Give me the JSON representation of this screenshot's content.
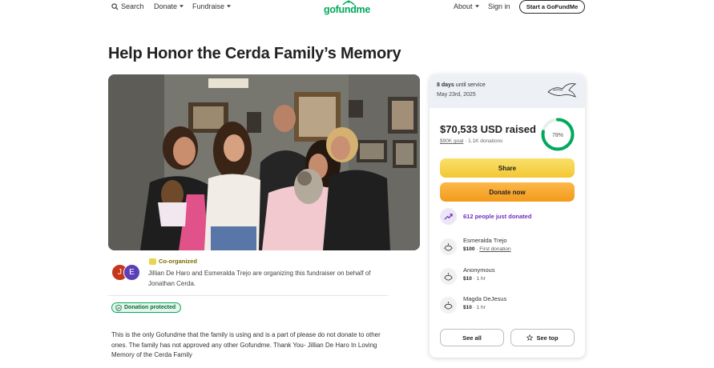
{
  "nav": {
    "search": "Search",
    "donate": "Donate",
    "fundraise": "Fundraise",
    "logo": "gofundme",
    "about": "About",
    "signin": "Sign in",
    "start": "Start a GoFundMe"
  },
  "page_title": "Help Honor the Cerda Family’s Memory",
  "organizer": {
    "initials": [
      "J",
      "E"
    ],
    "co_organized": "Co-organized",
    "text": "Jillian De Haro and Esmeralda Trejo are organizing this fundraiser on behalf of Jonathan Cerda.",
    "badge": "Donation protected"
  },
  "story": "This is the only Gofundme that the family is using and is a part of please do not donate to other ones. The family has not approved any other Gofundme. Thank You- Jillian De Haro In Loving Memory of the Cerda Family",
  "card": {
    "days": "8 days",
    "until": "until service",
    "service_date": "May 23rd, 2025",
    "raised": "$70,533 USD raised",
    "goal": "$90K goal",
    "donations": "· 1.1K donations",
    "percent_label": "78%",
    "percent": 0.78,
    "share": "Share",
    "donate_now": "Donate now",
    "recent": "612 people just donated",
    "donors": [
      {
        "name": "Esmeralda Trejo",
        "amount": "$100",
        "meta": "First donation"
      },
      {
        "name": "Anonymous",
        "amount": "$10",
        "meta": "1 hr"
      },
      {
        "name": "Magda DeJesus",
        "amount": "$10",
        "meta": "1 hr"
      }
    ],
    "see_all": "See all",
    "see_top": "See top"
  },
  "colors": {
    "brand_green": "#02a95c",
    "share_yellow": "#f3c734",
    "donate_orange": "#f39a1b",
    "purple": "#6f2dbd"
  }
}
